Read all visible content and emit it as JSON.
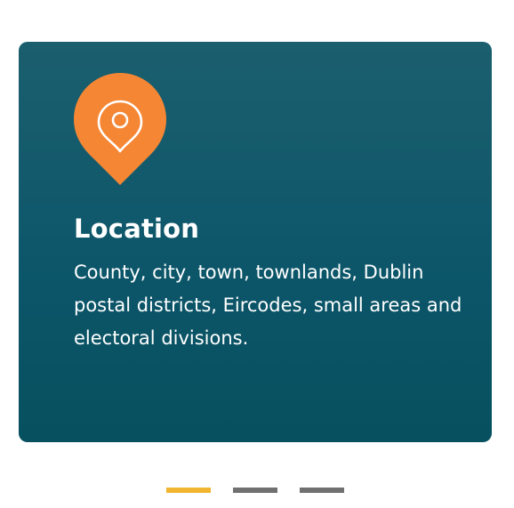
{
  "card": {
    "title": "Location",
    "description": "County, city, town, townlands, Dublin postal districts, Eircodes, small areas and electoral divisions.",
    "icon": "map-pin-icon",
    "background": "#0d566a",
    "icon_color": "#f58634"
  },
  "carousel": {
    "dots": [
      {
        "label": "slide-1",
        "active": true,
        "color": "#f2b531"
      },
      {
        "label": "slide-2",
        "active": false,
        "color": "#707070"
      },
      {
        "label": "slide-3",
        "active": false,
        "color": "#707070"
      }
    ]
  }
}
